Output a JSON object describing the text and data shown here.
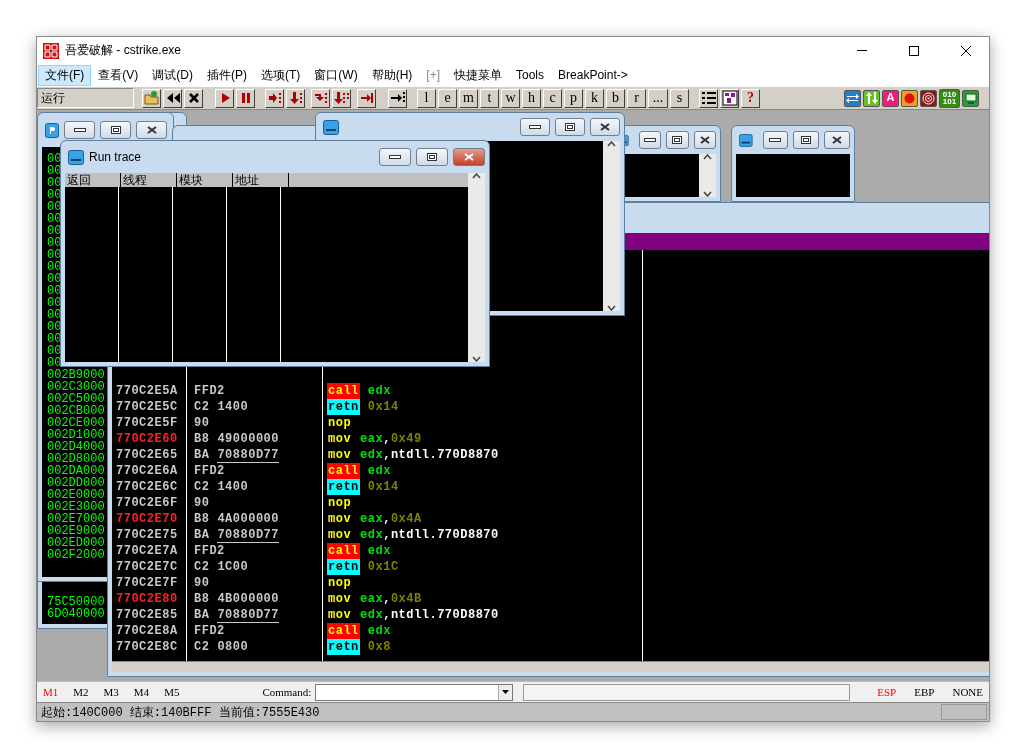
{
  "window": {
    "title": "吾爱破解 - cstrike.exe"
  },
  "menu": [
    {
      "label": "文件(F)",
      "selected": true,
      "disabled": false
    },
    {
      "label": "查看(V)",
      "selected": false,
      "disabled": false
    },
    {
      "label": "调试(D)",
      "selected": false,
      "disabled": false
    },
    {
      "label": "插件(P)",
      "selected": false,
      "disabled": false
    },
    {
      "label": "选项(T)",
      "selected": false,
      "disabled": false
    },
    {
      "label": "窗口(W)",
      "selected": false,
      "disabled": false
    },
    {
      "label": "帮助(H)",
      "selected": false,
      "disabled": false
    },
    {
      "label": "[+]",
      "selected": false,
      "disabled": true
    },
    {
      "label": "快捷菜单",
      "selected": false,
      "disabled": false
    },
    {
      "label": "Tools",
      "selected": false,
      "disabled": false
    },
    {
      "label": "BreakPoint->",
      "selected": false,
      "disabled": false
    }
  ],
  "toolbar": {
    "status": "运行",
    "letter_buttons": [
      "l",
      "e",
      "m",
      "t",
      "w",
      "h",
      "c",
      "p",
      "k",
      "b",
      "r",
      "...",
      "s"
    ],
    "help": "?",
    "quick_buttons": [
      {
        "kind": "swap"
      },
      {
        "kind": "updown"
      },
      {
        "kind": "letter",
        "label": "A"
      },
      {
        "kind": "record"
      },
      {
        "kind": "target"
      },
      {
        "kind": "binary",
        "label": "010 101"
      },
      {
        "kind": "monitor"
      }
    ]
  },
  "memory_window": {
    "rows": [
      "00",
      "00",
      "00",
      "00",
      "00",
      "00",
      "00",
      "00",
      "00",
      "00",
      "00",
      "00",
      "00",
      "00",
      "00",
      "00",
      "00",
      "00",
      "002B9000",
      "002C3000",
      "002C5000",
      "002CB000",
      "002CE000",
      "002D1000",
      "002D4000",
      "002D8000",
      "002DA000",
      "002DD000",
      "002E0000",
      "002E3000",
      "002E7000",
      "002E9000",
      "002ED000",
      "002F2000"
    ]
  },
  "memory_window_2": {
    "rows": [
      "75C50000",
      "6D040000"
    ]
  },
  "run_trace": {
    "title": "Run trace",
    "columns": [
      "返回",
      "线程",
      "模块",
      "地址"
    ]
  },
  "cpu": {
    "rows": [
      {
        "address": "770C2E5A",
        "marked": false,
        "opcode": "FFD2",
        "mnemonic": "call",
        "operands": [
          {
            "text": "edx",
            "kind": "reg"
          }
        ]
      },
      {
        "address": "770C2E5C",
        "marked": false,
        "opcode": "C2",
        "operand_bytes": "1400",
        "fixup": false,
        "mnemonic": "retn",
        "operands": [
          {
            "text": "0x14",
            "kind": "imm"
          }
        ]
      },
      {
        "address": "770C2E5F",
        "marked": false,
        "opcode": "90",
        "mnemonic": "nop",
        "operands": []
      },
      {
        "address": "770C2E60",
        "marked": true,
        "opcode": "B8",
        "operand_bytes": "49000000",
        "fixup": false,
        "mnemonic": "mov",
        "operands": [
          {
            "text": "eax",
            "kind": "reg"
          },
          {
            "text": ",",
            "kind": "sym"
          },
          {
            "text": "0x49",
            "kind": "imm"
          }
        ]
      },
      {
        "address": "770C2E65",
        "marked": false,
        "opcode": "BA",
        "operand_bytes": "70880D77",
        "fixup": true,
        "mnemonic": "mov",
        "operands": [
          {
            "text": "edx",
            "kind": "reg"
          },
          {
            "text": ",ntdll.770D8870",
            "kind": "sym"
          }
        ]
      },
      {
        "address": "770C2E6A",
        "marked": false,
        "opcode": "FFD2",
        "mnemonic": "call",
        "operands": [
          {
            "text": "edx",
            "kind": "reg"
          }
        ]
      },
      {
        "address": "770C2E6C",
        "marked": false,
        "opcode": "C2",
        "operand_bytes": "1400",
        "fixup": false,
        "mnemonic": "retn",
        "operands": [
          {
            "text": "0x14",
            "kind": "imm"
          }
        ]
      },
      {
        "address": "770C2E6F",
        "marked": false,
        "opcode": "90",
        "mnemonic": "nop",
        "operands": []
      },
      {
        "address": "770C2E70",
        "marked": true,
        "opcode": "B8",
        "operand_bytes": "4A000000",
        "fixup": false,
        "mnemonic": "mov",
        "operands": [
          {
            "text": "eax",
            "kind": "reg"
          },
          {
            "text": ",",
            "kind": "sym"
          },
          {
            "text": "0x4A",
            "kind": "imm"
          }
        ]
      },
      {
        "address": "770C2E75",
        "marked": false,
        "opcode": "BA",
        "operand_bytes": "70880D77",
        "fixup": true,
        "mnemonic": "mov",
        "operands": [
          {
            "text": "edx",
            "kind": "reg"
          },
          {
            "text": ",ntdll.770D8870",
            "kind": "sym"
          }
        ]
      },
      {
        "address": "770C2E7A",
        "marked": false,
        "opcode": "FFD2",
        "mnemonic": "call",
        "operands": [
          {
            "text": "edx",
            "kind": "reg"
          }
        ]
      },
      {
        "address": "770C2E7C",
        "marked": false,
        "opcode": "C2",
        "operand_bytes": "1C00",
        "fixup": false,
        "mnemonic": "retn",
        "operands": [
          {
            "text": "0x1C",
            "kind": "imm"
          }
        ]
      },
      {
        "address": "770C2E7F",
        "marked": false,
        "opcode": "90",
        "mnemonic": "nop",
        "operands": []
      },
      {
        "address": "770C2E80",
        "marked": true,
        "opcode": "B8",
        "operand_bytes": "4B000000",
        "fixup": false,
        "mnemonic": "mov",
        "operands": [
          {
            "text": "eax",
            "kind": "reg"
          },
          {
            "text": ",",
            "kind": "sym"
          },
          {
            "text": "0x4B",
            "kind": "imm"
          }
        ]
      },
      {
        "address": "770C2E85",
        "marked": false,
        "opcode": "BA",
        "operand_bytes": "70880D77",
        "fixup": true,
        "mnemonic": "mov",
        "operands": [
          {
            "text": "edx",
            "kind": "reg"
          },
          {
            "text": ",ntdll.770D8870",
            "kind": "sym"
          }
        ]
      },
      {
        "address": "770C2E8A",
        "marked": false,
        "opcode": "FFD2",
        "mnemonic": "call",
        "operands": [
          {
            "text": "edx",
            "kind": "reg"
          }
        ]
      },
      {
        "address": "770C2E8C",
        "marked": false,
        "opcode": "C2",
        "operand_bytes": "0800",
        "fixup": false,
        "mnemonic": "retn",
        "operands": [
          {
            "text": "0x8",
            "kind": "imm"
          }
        ]
      }
    ]
  },
  "command_bar": {
    "marks": [
      {
        "label": "M1",
        "selected": true
      },
      {
        "label": "M2",
        "selected": false
      },
      {
        "label": "M3",
        "selected": false
      },
      {
        "label": "M4",
        "selected": false
      },
      {
        "label": "M5",
        "selected": false
      }
    ],
    "command_label": "Command:",
    "registers": [
      {
        "label": "ESP",
        "selected": true
      },
      {
        "label": "EBP",
        "selected": false
      },
      {
        "label": "NONE",
        "selected": false
      }
    ]
  },
  "status_bar": "起始:140C000 结束:140BFFF 当前值:7555E430"
}
